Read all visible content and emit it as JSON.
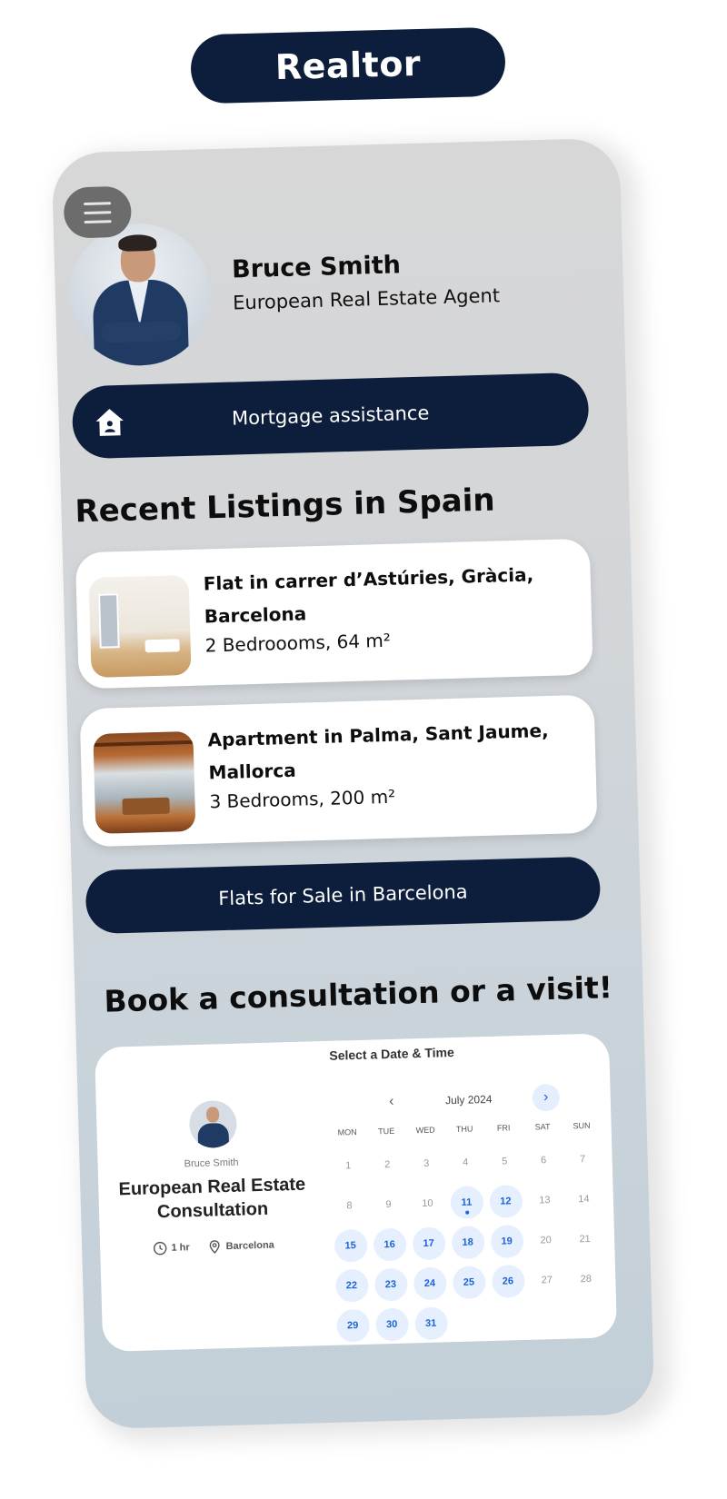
{
  "badge": {
    "title": "Realtor"
  },
  "profile": {
    "name": "Bruce Smith",
    "role": "European Real Estate Agent"
  },
  "mortgage": {
    "label": "Mortgage assistance",
    "icon": "house-icon"
  },
  "listings": {
    "heading": "Recent Listings in Spain",
    "items": [
      {
        "title": "Flat in carrer d’Astúries, Gràcia, Barcelona",
        "details": "2 Bedroooms, 64 m²"
      },
      {
        "title": "Apartment in Palma, Sant Jaume, Mallorca",
        "details": "3 Bedrooms, 200 m²"
      }
    ],
    "more_button": "Flats for Sale in Barcelona"
  },
  "booking": {
    "heading": "Book a consultation or a visit!",
    "host": "Bruce Smith",
    "event_title": "European Real Estate Consultation",
    "duration": "1 hr",
    "location": "Barcelona",
    "calendar": {
      "heading": "Select a Date & Time",
      "month": "July 2024",
      "prev": "‹",
      "next": "›",
      "weekdays": [
        "MON",
        "TUE",
        "WED",
        "THU",
        "FRI",
        "SAT",
        "SUN"
      ],
      "days": [
        {
          "d": "1",
          "a": false
        },
        {
          "d": "2",
          "a": false
        },
        {
          "d": "3",
          "a": false
        },
        {
          "d": "4",
          "a": false
        },
        {
          "d": "5",
          "a": false
        },
        {
          "d": "6",
          "a": false
        },
        {
          "d": "7",
          "a": false
        },
        {
          "d": "8",
          "a": false
        },
        {
          "d": "9",
          "a": false
        },
        {
          "d": "10",
          "a": false
        },
        {
          "d": "11",
          "a": true,
          "today": true
        },
        {
          "d": "12",
          "a": true
        },
        {
          "d": "13",
          "a": false
        },
        {
          "d": "14",
          "a": false
        },
        {
          "d": "15",
          "a": true
        },
        {
          "d": "16",
          "a": true
        },
        {
          "d": "17",
          "a": true
        },
        {
          "d": "18",
          "a": true
        },
        {
          "d": "19",
          "a": true
        },
        {
          "d": "20",
          "a": false
        },
        {
          "d": "21",
          "a": false
        },
        {
          "d": "22",
          "a": true
        },
        {
          "d": "23",
          "a": true
        },
        {
          "d": "24",
          "a": true
        },
        {
          "d": "25",
          "a": true
        },
        {
          "d": "26",
          "a": true
        },
        {
          "d": "27",
          "a": false
        },
        {
          "d": "28",
          "a": false
        },
        {
          "d": "29",
          "a": true
        },
        {
          "d": "30",
          "a": true
        },
        {
          "d": "31",
          "a": true
        }
      ]
    }
  },
  "colors": {
    "navy": "#0c1e3c",
    "accent_blue": "#1a63d8",
    "available_bg": "#e6effd"
  }
}
